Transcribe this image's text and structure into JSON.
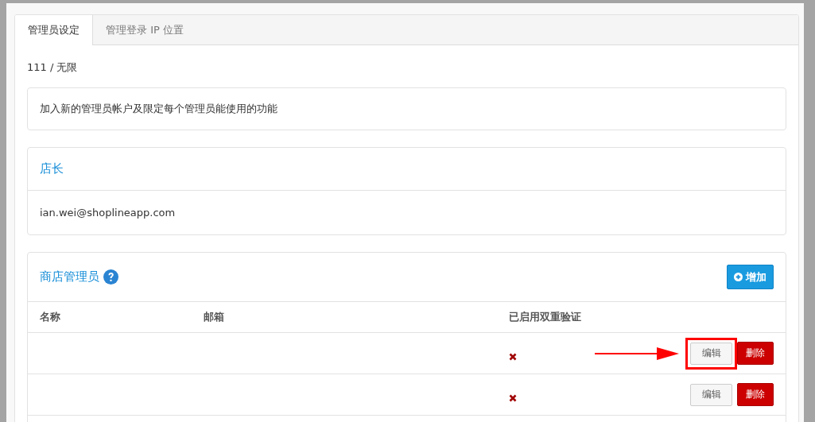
{
  "tabs": [
    {
      "label": "管理员设定",
      "selected": true
    },
    {
      "label": "管理登录 IP 位置",
      "selected": false
    }
  ],
  "quota": "111 / 无限",
  "notice": "加入新的管理员帐户及限定每个管理员能使用的功能",
  "owner": {
    "title": "店长",
    "email": "ian.wei@shoplineapp.com"
  },
  "admins": {
    "title": "商店管理员",
    "add_button": "增加",
    "columns": [
      "名称",
      "邮箱",
      "已启用双重验证"
    ],
    "rows": [
      {
        "name": "",
        "email": "",
        "two_factor": false,
        "edit": "编辑",
        "delete": "删除",
        "highlighted": true
      },
      {
        "name": "",
        "email": "",
        "two_factor": false,
        "edit": "编辑",
        "delete": "删除",
        "highlighted": false
      }
    ]
  }
}
